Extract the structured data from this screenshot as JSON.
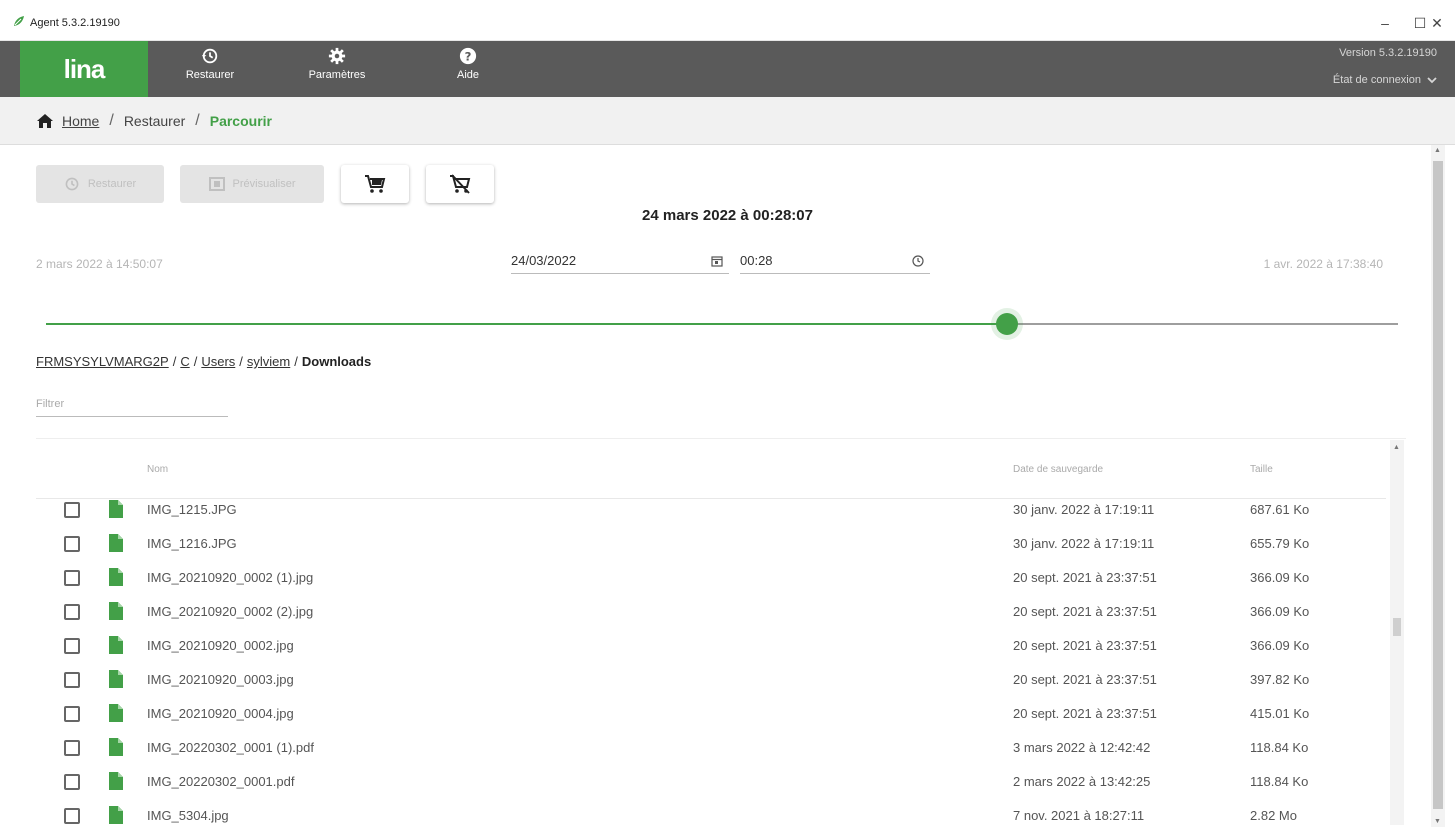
{
  "window": {
    "title": "Agent 5.3.2.19190",
    "minimize": "–",
    "maximize": "☐",
    "close": "✕"
  },
  "nav": {
    "logo": "lina",
    "items": [
      {
        "label": "Restaurer",
        "icon": "history-icon"
      },
      {
        "label": "Paramètres",
        "icon": "gear-icon"
      },
      {
        "label": "Aide",
        "icon": "help-icon"
      }
    ],
    "version": "Version 5.3.2.19190",
    "connection": "État de connexion"
  },
  "breadcrumb": {
    "home": "Home",
    "restaurer": "Restaurer",
    "current": "Parcourir",
    "separator": "/"
  },
  "toolbar": {
    "restaurer": "Restaurer",
    "previsualiser": "Prévisualiser"
  },
  "snapshot": {
    "title": "24 mars 2022 à 00:28:07",
    "range_start": "2 mars 2022 à 14:50:07",
    "range_end": "1 avr. 2022 à 17:38:40",
    "date_value": "24/03/2022",
    "time_value": "00:28",
    "slider_fraction": 0.711
  },
  "path": {
    "segments": [
      "FRMSYSYLVMARG2P",
      "C",
      "Users",
      "sylviem"
    ],
    "current": "Downloads",
    "separator": "/"
  },
  "filter": {
    "placeholder": "Filtrer"
  },
  "table": {
    "headers": {
      "name": "Nom",
      "date": "Date de sauvegarde",
      "size": "Taille"
    },
    "rows": [
      {
        "name": "IMG_1215.JPG",
        "date": "30 janv. 2022 à 17:19:11",
        "size": "687.61 Ko"
      },
      {
        "name": "IMG_1216.JPG",
        "date": "30 janv. 2022 à 17:19:11",
        "size": "655.79 Ko"
      },
      {
        "name": "IMG_20210920_0002 (1).jpg",
        "date": "20 sept. 2021 à 23:37:51",
        "size": "366.09 Ko"
      },
      {
        "name": "IMG_20210920_0002 (2).jpg",
        "date": "20 sept. 2021 à 23:37:51",
        "size": "366.09 Ko"
      },
      {
        "name": "IMG_20210920_0002.jpg",
        "date": "20 sept. 2021 à 23:37:51",
        "size": "366.09 Ko"
      },
      {
        "name": "IMG_20210920_0003.jpg",
        "date": "20 sept. 2021 à 23:37:51",
        "size": "397.82 Ko"
      },
      {
        "name": "IMG_20210920_0004.jpg",
        "date": "20 sept. 2021 à 23:37:51",
        "size": "415.01 Ko"
      },
      {
        "name": "IMG_20220302_0001 (1).pdf",
        "date": "3 mars 2022 à 12:42:42",
        "size": "118.84 Ko"
      },
      {
        "name": "IMG_20220302_0001.pdf",
        "date": "2 mars 2022 à 13:42:25",
        "size": "118.84 Ko"
      },
      {
        "name": "IMG_5304.jpg",
        "date": "7 nov. 2021 à 18:27:11",
        "size": "2.82 Mo"
      }
    ]
  },
  "colors": {
    "accent": "#43a048",
    "nav_bg": "#5a5a5a",
    "breadcrumb_bg": "#f1f1f1"
  }
}
